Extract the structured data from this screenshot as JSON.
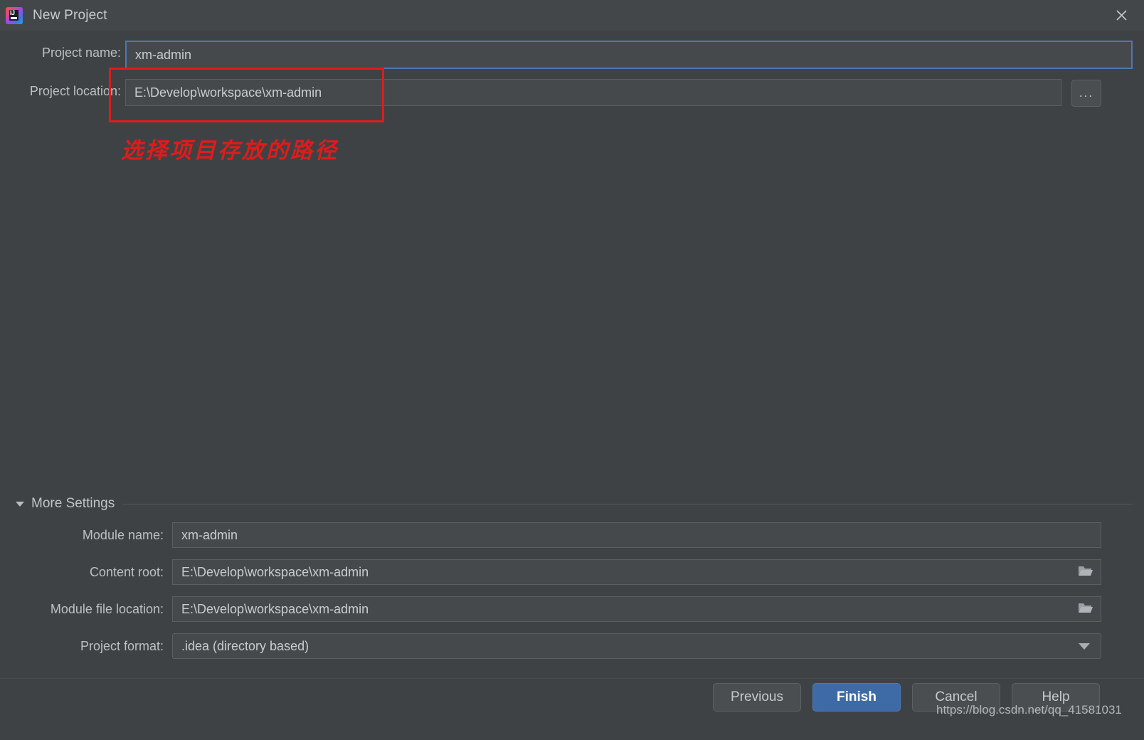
{
  "window": {
    "title": "New Project",
    "app_icon": "intellij-idea-logo",
    "close_icon": "close-icon"
  },
  "form": {
    "project_name": {
      "label": "Project name:",
      "value": "xm-admin",
      "focused": true
    },
    "project_location": {
      "label": "Project location:",
      "value": "E:\\Develop\\workspace\\xm-admin",
      "browse_label": "..."
    }
  },
  "annotation": {
    "text": "选择项目存放的路径",
    "color": "#e01b1b"
  },
  "more_settings": {
    "label": "More Settings",
    "expanded": true,
    "collapse_icon": "triangle-down-icon",
    "fields": [
      {
        "label": "Module name:",
        "value": "xm-admin",
        "trailing_icon": null
      },
      {
        "label": "Content root:",
        "value": "E:\\Develop\\workspace\\xm-admin",
        "trailing_icon": "folder-icon"
      },
      {
        "label": "Module file location:",
        "value": "E:\\Develop\\workspace\\xm-admin",
        "trailing_icon": "folder-icon"
      },
      {
        "label": "Project format:",
        "value": ".idea (directory based)",
        "trailing_icon": "chevron-down-icon"
      }
    ]
  },
  "footer": {
    "buttons": [
      {
        "label": "Previous",
        "primary": false
      },
      {
        "label": "Finish",
        "primary": true
      },
      {
        "label": "Cancel",
        "primary": false
      },
      {
        "label": "Help",
        "primary": false
      }
    ],
    "watermark": "https://blog.csdn.net/qq_41581031"
  },
  "colors": {
    "background": "#3f4244",
    "titlebar": "#43474a",
    "field": "#45494c",
    "accent_blue": "#3e6ba5",
    "focus_border": "#4b78b3",
    "annotation_red": "#e01b1b"
  }
}
